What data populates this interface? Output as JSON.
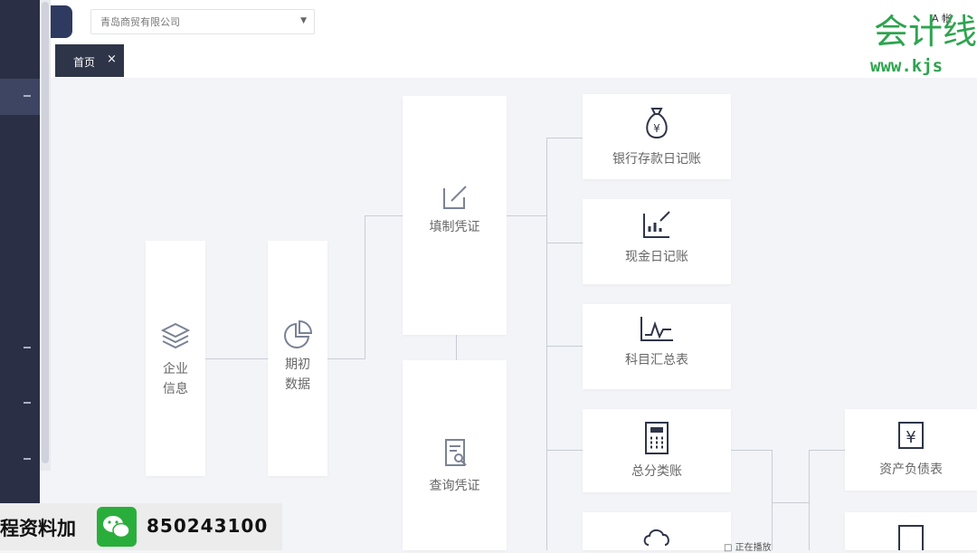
{
  "window": {
    "corner_text": "A 帐"
  },
  "company_select": {
    "value": "青岛商贸有限公司"
  },
  "tabs": [
    {
      "label": "首页",
      "close": "×"
    }
  ],
  "watermark": {
    "brand": "会计线",
    "url": "www.kjs"
  },
  "flow": {
    "company_info": "企业信息",
    "opening_data": "期初数据",
    "fill_voucher": "填制凭证",
    "query_voucher": "查询凭证",
    "bank_journal": "银行存款日记账",
    "cash_journal": "现金日记账",
    "subject_summary": "科目汇总表",
    "detail_ledger": "总分类账",
    "balance_sheet": "资产负债表"
  },
  "promo": {
    "text": "程资料加",
    "number": "850243100"
  },
  "tray": {
    "text": "□ 正在播放"
  },
  "icons": [
    "layers-icon",
    "pie-chart-icon",
    "edit-icon",
    "document-search-icon",
    "money-bag-icon",
    "cash-chart-icon",
    "line-chart-icon",
    "calculator-icon",
    "yen-doc-icon",
    "wechat-icon"
  ]
}
